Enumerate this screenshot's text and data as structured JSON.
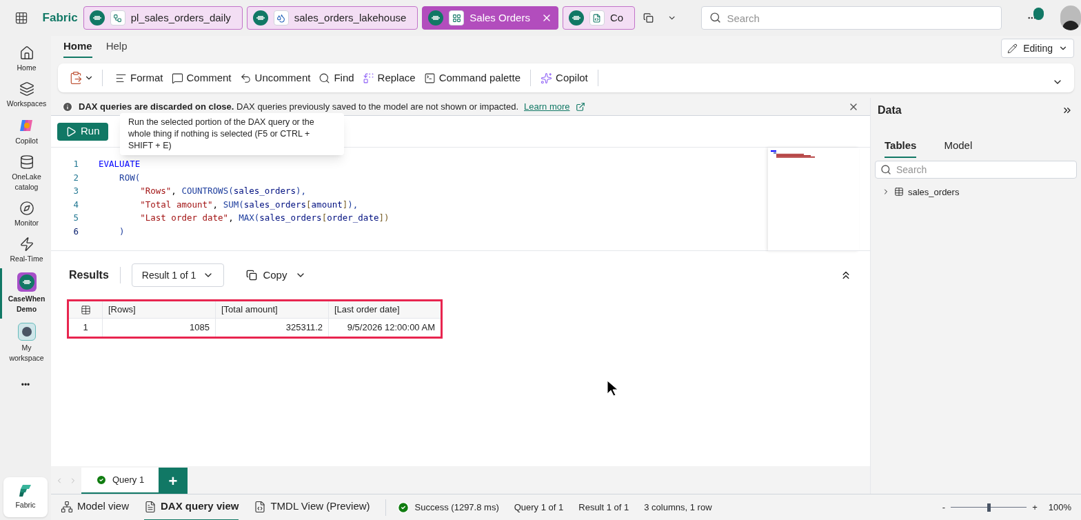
{
  "app_title": "Fabric",
  "tabs": [
    {
      "label": "pl_sales_orders_daily",
      "kind": "pipeline",
      "selected": false
    },
    {
      "label": "sales_orders_lakehouse",
      "kind": "lakehouse",
      "selected": false
    },
    {
      "label": "Sales Orders",
      "kind": "model",
      "selected": true
    },
    {
      "label": "Co",
      "kind": "notebook",
      "selected": false
    }
  ],
  "search": {
    "placeholder": "Search"
  },
  "rail": [
    {
      "label": "Home",
      "kind": "home",
      "selected": false
    },
    {
      "label": "Workspaces",
      "kind": "workspaces",
      "selected": false
    },
    {
      "label": "Copilot",
      "kind": "copilot",
      "selected": false
    },
    {
      "label": "OneLake catalog",
      "kind": "onelake",
      "selected": false
    },
    {
      "label": "Monitor",
      "kind": "monitor",
      "selected": false
    },
    {
      "label": "Real-Time",
      "kind": "realtime",
      "selected": false
    },
    {
      "label": "CaseWhen Demo",
      "kind": "workspace",
      "selected": true
    },
    {
      "label": "My workspace",
      "kind": "myworkspace",
      "selected": false
    }
  ],
  "rail_more": "•••",
  "rail_footer": "Fabric",
  "ribbon_tabs": [
    {
      "label": "Home",
      "selected": true
    },
    {
      "label": "Help",
      "selected": false
    }
  ],
  "mode_button": "Editing",
  "toolbar": [
    {
      "label": "Format",
      "kind": "format"
    },
    {
      "label": "Comment",
      "kind": "comment"
    },
    {
      "label": "Uncomment",
      "kind": "uncomment"
    },
    {
      "label": "Find",
      "kind": "find"
    },
    {
      "label": "Replace",
      "kind": "replace"
    },
    {
      "label": "Command palette",
      "kind": "palette"
    },
    {
      "label": "Copilot",
      "kind": "copilot"
    }
  ],
  "banner": {
    "text": "**DAX queries are discarded on close.** DAX queries previously saved to the model are not shown or impacted.",
    "link": "Learn more"
  },
  "run_button": "Run",
  "tooltip": "Run the selected portion of the DAX query or the whole thing if nothing is selected (F5 or CTRL + SHIFT + E)",
  "code": [
    {
      "number": "1",
      "selected": false,
      "tokens": [
        {
          "text": "EVALUATE",
          "kind": "keyword"
        }
      ]
    },
    {
      "number": "2",
      "selected": false,
      "tokens": [
        {
          "text": "    ROW(",
          "kind": "function"
        }
      ]
    },
    {
      "number": "3",
      "selected": false,
      "tokens": [
        {
          "text": "        \"Rows\"",
          "kind": "string"
        },
        {
          "text": ", ",
          "kind": "punct"
        },
        {
          "text": "COUNTROWS(",
          "kind": "function"
        },
        {
          "text": "sales_orders",
          "kind": "ident"
        },
        {
          "text": "),",
          "kind": "function"
        }
      ]
    },
    {
      "number": "4",
      "selected": false,
      "tokens": [
        {
          "text": "        \"Total amount\"",
          "kind": "string"
        },
        {
          "text": ", ",
          "kind": "punct"
        },
        {
          "text": "SUM(",
          "kind": "function"
        },
        {
          "text": "sales_orders",
          "kind": "ident"
        },
        {
          "text": "[",
          "kind": "bracket"
        },
        {
          "text": "amount",
          "kind": "ident"
        },
        {
          "text": "]",
          "kind": "bracket"
        },
        {
          "text": "),",
          "kind": "function"
        }
      ]
    },
    {
      "number": "5",
      "selected": false,
      "tokens": [
        {
          "text": "        \"Last order date\"",
          "kind": "string"
        },
        {
          "text": ", ",
          "kind": "punct"
        },
        {
          "text": "MAX(",
          "kind": "function"
        },
        {
          "text": "sales_orders",
          "kind": "ident"
        },
        {
          "text": "[",
          "kind": "bracket"
        },
        {
          "text": "order_date",
          "kind": "ident"
        },
        {
          "text": "])",
          "kind": "bracket"
        }
      ]
    },
    {
      "number": "6",
      "selected": true,
      "tokens": [
        {
          "text": "    )",
          "kind": "function"
        }
      ]
    }
  ],
  "results": {
    "title": "Results",
    "result_picker": "Result 1 of 1",
    "copy": "Copy",
    "columns": [
      "[Rows]",
      "[Total amount]",
      "[Last order date]"
    ],
    "rows": [
      {
        "index": "1",
        "cells": [
          "1085",
          "325311.2",
          "9/5/2026 12:00:00 AM"
        ]
      }
    ]
  },
  "query_tabs": [
    {
      "label": "Query 1",
      "selected": true
    }
  ],
  "add_query": "+",
  "views": [
    {
      "label": "Model view",
      "kind": "model",
      "selected": false
    },
    {
      "label": "DAX query view",
      "kind": "dax",
      "selected": true
    },
    {
      "label": "TMDL View (Preview)",
      "kind": "tmdl",
      "selected": false
    }
  ],
  "status": {
    "success": "Success (1297.8 ms)",
    "items": [
      "Query 1 of 1",
      "Result 1 of 1",
      "3 columns, 1 row"
    ],
    "zoom_out": "-",
    "zoom_in": "+",
    "zoom": {
      "level": 0.5
    },
    "zoom_reading": "100%"
  },
  "data_pane": {
    "title": "Data",
    "tabs": [
      {
        "label": "Tables",
        "selected": true
      },
      {
        "label": "Model",
        "selected": false
      }
    ],
    "search_placeholder": "Search",
    "tree": [
      {
        "label": "sales_orders",
        "expanded": false
      }
    ]
  }
}
